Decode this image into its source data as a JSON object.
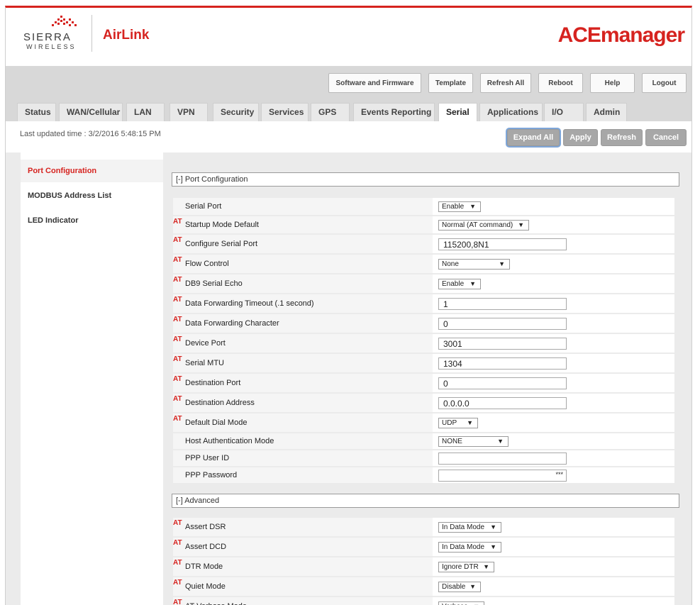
{
  "header": {
    "brand_top": "SIERRA",
    "brand_bottom": "WIRELESS",
    "product": "AirLink",
    "app_title": "ACEmanager"
  },
  "top_buttons": {
    "software": "Software and Firmware",
    "template": "Template",
    "refresh_all": "Refresh All",
    "reboot": "Reboot",
    "help": "Help",
    "logout": "Logout"
  },
  "tabs": [
    "Status",
    "WAN/Cellular",
    "LAN",
    "VPN",
    "Security",
    "Services",
    "GPS",
    "Events Reporting",
    "Serial",
    "Applications",
    "I/O",
    "Admin"
  ],
  "active_tab": "Serial",
  "toolbar": {
    "last_updated": "Last updated time : 3/2/2016 5:48:15 PM",
    "expand_all": "Expand All",
    "apply": "Apply",
    "refresh": "Refresh",
    "cancel": "Cancel"
  },
  "sidebar": {
    "items": [
      "Port Configuration",
      "MODBUS Address List",
      "LED Indicator"
    ],
    "active": "Port Configuration"
  },
  "sections": {
    "port_config": "[-] Port Configuration",
    "advanced": "[-] Advanced"
  },
  "at_tag": "AT",
  "port_rows": [
    {
      "label": "Serial Port",
      "at": false,
      "type": "select",
      "value": "Enable"
    },
    {
      "label": "Startup Mode Default",
      "at": true,
      "type": "select",
      "value": "Normal (AT command)"
    },
    {
      "label": "Configure Serial Port",
      "at": true,
      "type": "text",
      "value": "115200,8N1"
    },
    {
      "label": "Flow Control",
      "at": true,
      "type": "select",
      "value": "None"
    },
    {
      "label": "DB9 Serial Echo",
      "at": true,
      "type": "select",
      "value": "Enable"
    },
    {
      "label": "Data Forwarding Timeout (.1 second)",
      "at": true,
      "type": "text",
      "value": "1"
    },
    {
      "label": "Data Forwarding Character",
      "at": true,
      "type": "text",
      "value": "0"
    },
    {
      "label": "Device Port",
      "at": true,
      "type": "text",
      "value": "3001"
    },
    {
      "label": "Serial MTU",
      "at": true,
      "type": "text",
      "value": "1304"
    },
    {
      "label": "Destination Port",
      "at": true,
      "type": "text",
      "value": "0"
    },
    {
      "label": "Destination Address",
      "at": true,
      "type": "text",
      "value": "0.0.0.0"
    },
    {
      "label": "Default Dial Mode",
      "at": true,
      "type": "select",
      "value": "UDP"
    },
    {
      "label": "Host Authentication Mode",
      "at": false,
      "type": "select",
      "value": "NONE"
    },
    {
      "label": "PPP User ID",
      "at": false,
      "type": "text",
      "value": ""
    },
    {
      "label": "PPP Password",
      "at": false,
      "type": "password",
      "value": "***"
    }
  ],
  "advanced_rows": [
    {
      "label": "Assert DSR",
      "at": true,
      "type": "select",
      "value": "In Data Mode"
    },
    {
      "label": "Assert DCD",
      "at": true,
      "type": "select",
      "value": "In Data Mode"
    },
    {
      "label": "DTR Mode",
      "at": true,
      "type": "select",
      "value": "Ignore DTR"
    },
    {
      "label": "Quiet Mode",
      "at": true,
      "type": "select",
      "value": "Disable"
    },
    {
      "label": "AT Verbose Mode",
      "at": true,
      "type": "select",
      "value": "Verbose"
    }
  ],
  "colors": {
    "brand_red": "#d6231f",
    "band_gray": "#d8d8d8",
    "button_gray": "#a7a7a7"
  }
}
